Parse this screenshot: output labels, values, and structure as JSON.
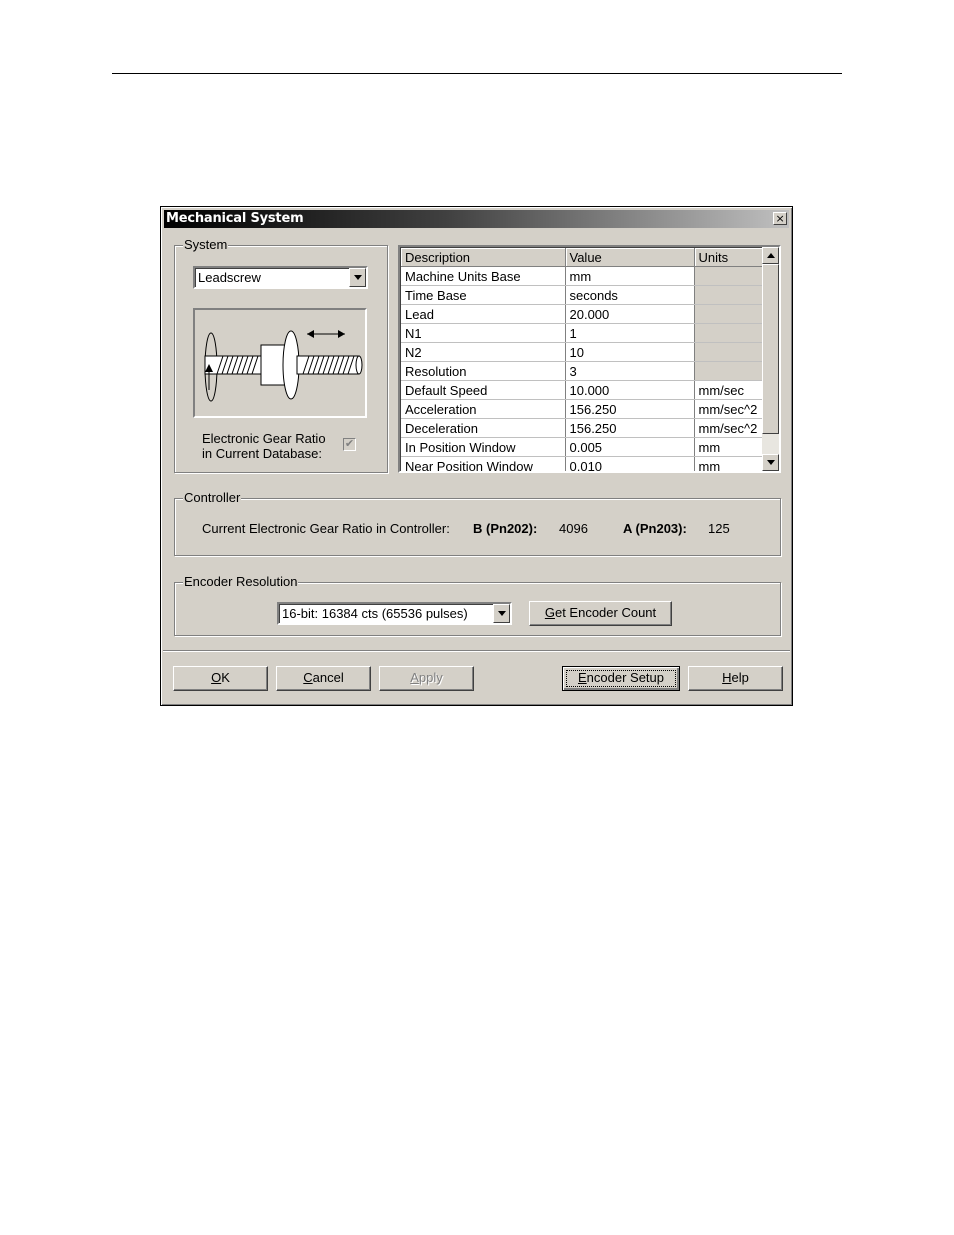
{
  "window": {
    "title": "Mechanical System",
    "close_glyph": "×"
  },
  "system": {
    "group_label": "System",
    "type_value": "Leadscrew",
    "gear_ratio_label_line1": "Electronic Gear Ratio",
    "gear_ratio_label_line2": "in Current Database:",
    "gear_ratio_checked": true
  },
  "grid": {
    "headers": {
      "description": "Description",
      "value": "Value",
      "units": "Units"
    },
    "rows": [
      {
        "description": "Machine Units Base",
        "value": "mm",
        "units": ""
      },
      {
        "description": "Time Base",
        "value": "seconds",
        "units": ""
      },
      {
        "description": "Lead",
        "value": "20.000",
        "units": ""
      },
      {
        "description": "N1",
        "value": "1",
        "units": ""
      },
      {
        "description": "N2",
        "value": "10",
        "units": ""
      },
      {
        "description": "Resolution",
        "value": "3",
        "units": ""
      },
      {
        "description": "Default Speed",
        "value": "10.000",
        "units": "mm/sec"
      },
      {
        "description": "Acceleration",
        "value": "156.250",
        "units": "mm/sec^2"
      },
      {
        "description": "Deceleration",
        "value": "156.250",
        "units": "mm/sec^2"
      },
      {
        "description": "In Position Window",
        "value": "0.005",
        "units": "mm"
      },
      {
        "description": "Near Position Window",
        "value": "0.010",
        "units": "mm"
      }
    ]
  },
  "controller": {
    "group_label": "Controller",
    "label": "Current Electronic Gear Ratio in Controller:",
    "b_label": "B (Pn202):",
    "b_value": "4096",
    "a_label": "A (Pn203):",
    "a_value": "125"
  },
  "encoder": {
    "group_label": "Encoder Resolution",
    "selected": "16-bit: 16384 cts (65536 pulses)",
    "get_count": {
      "mnemonic": "G",
      "rest": "et Encoder Count"
    }
  },
  "buttons": {
    "ok": {
      "mnemonic": "O",
      "rest": "K"
    },
    "cancel": {
      "mnemonic": "C",
      "rest": "ancel"
    },
    "apply": {
      "mnemonic": "A",
      "rest": "pply"
    },
    "encoder_setup": {
      "mnemonic": "E",
      "rest": "ncoder Setup"
    },
    "help": {
      "mnemonic": "H",
      "rest": "elp"
    }
  }
}
